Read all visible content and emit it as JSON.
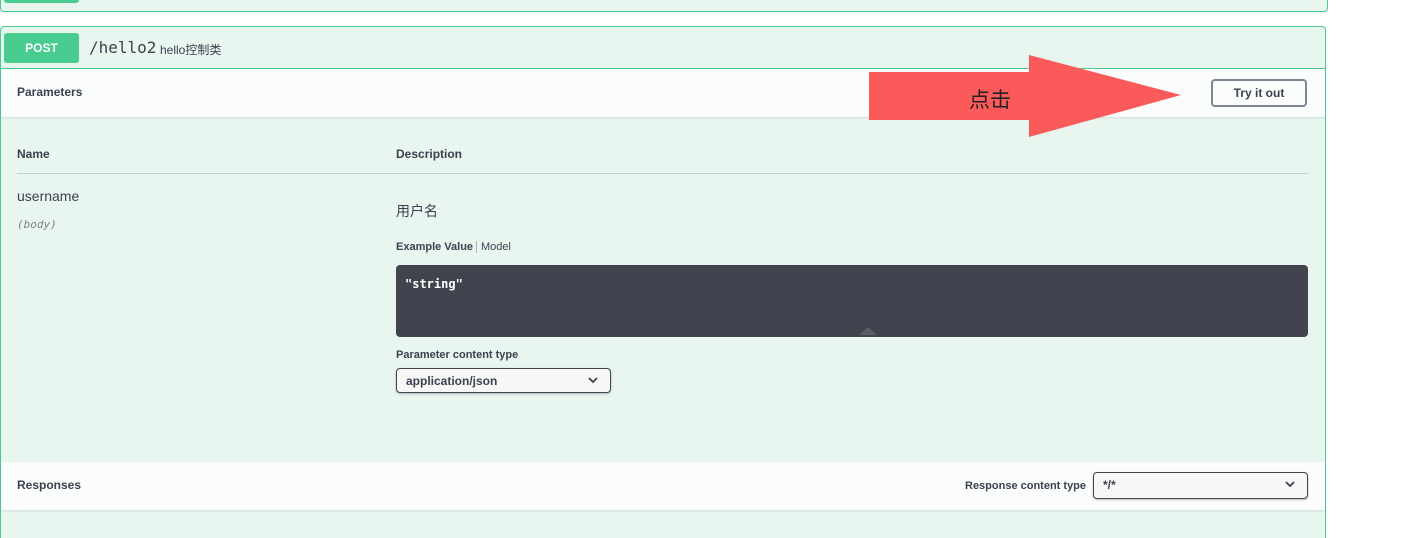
{
  "operation": {
    "method": "POST",
    "path": "/hello2",
    "summary": "hello控制类"
  },
  "parameters_section": {
    "title": "Parameters",
    "try_button": "Try it out",
    "columns": {
      "name": "Name",
      "description": "Description"
    },
    "params": [
      {
        "name": "username",
        "in": "(body)",
        "description": "用户名",
        "tabs": {
          "example": "Example Value",
          "model": "Model"
        },
        "example_value": "\"string\"",
        "content_type_label": "Parameter content type",
        "content_type_value": "application/json"
      }
    ]
  },
  "responses_section": {
    "title": "Responses",
    "content_type_label": "Response content type",
    "content_type_value": "*/*"
  },
  "annotation": {
    "label": "点击",
    "color": "#fb5a5a"
  },
  "colors": {
    "post_green": "#49cc90",
    "block_bg": "#e8f6ef",
    "code_bg": "#41444e"
  }
}
